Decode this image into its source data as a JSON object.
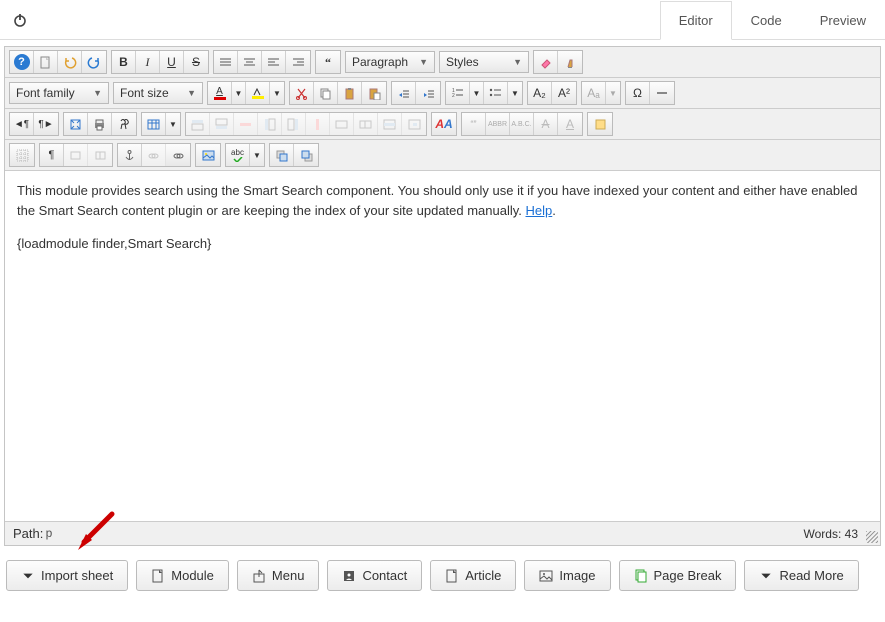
{
  "tabs": {
    "editor": "Editor",
    "code": "Code",
    "preview": "Preview"
  },
  "toolbar": {
    "paragraph": "Paragraph",
    "styles": "Styles",
    "fontfamily": "Font family",
    "fontsize": "Font size",
    "abc": "ABC",
    "aaa": "A.B.C.",
    "quote": "“”",
    "a": "A",
    "a2": "A²",
    "asub": "A₂"
  },
  "content": {
    "text1": "This module provides search using the Smart Search component. You should only use it if you have indexed your content and either have enabled the Smart Search content plugin or are keeping the index of your site updated manually. ",
    "help_link": "Help",
    "text2": "{loadmodule finder,Smart Search}"
  },
  "status": {
    "path_label": "Path:",
    "path_value": "p",
    "words_label": "Words:",
    "words_value": "43"
  },
  "buttons": {
    "import": "Import sheet",
    "module": "Module",
    "menu": "Menu",
    "contact": "Contact",
    "article": "Article",
    "image": "Image",
    "pagebreak": "Page Break",
    "readmore": "Read More"
  }
}
